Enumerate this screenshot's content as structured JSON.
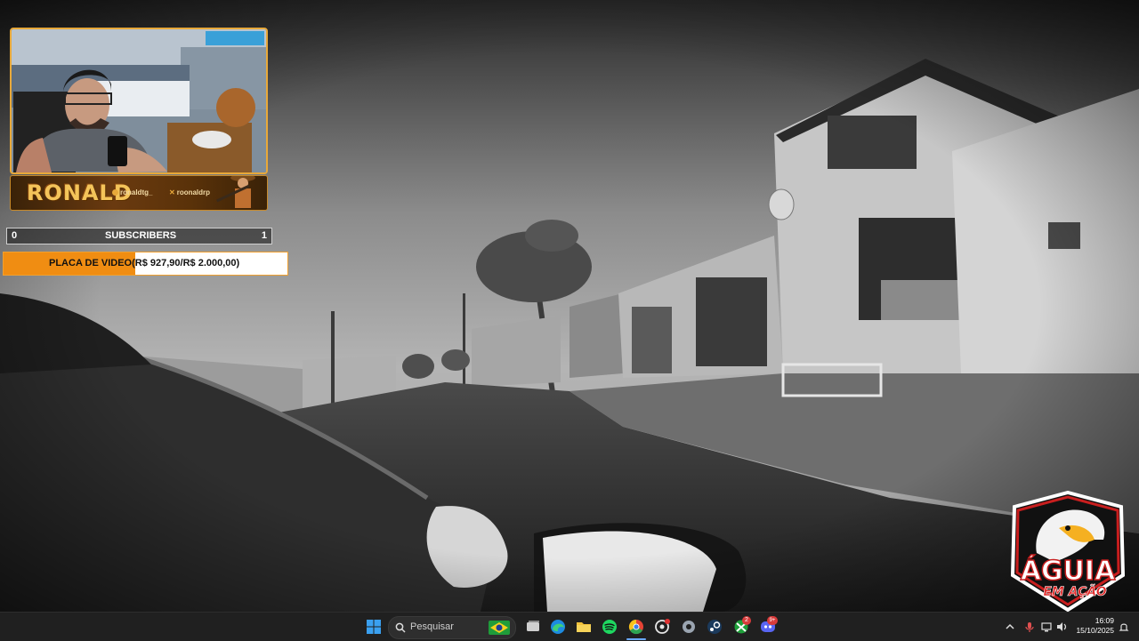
{
  "stream_overlay": {
    "streamer_name": "RONALD",
    "social_instagram": "ronaldtg_",
    "social_x": "roonaldrp",
    "subscribers": {
      "left_count": "0",
      "label": "SUBSCRIBERS",
      "right_count": "1"
    },
    "goal": {
      "title": "PLACA DE VIDEO",
      "progress_text": "(R$ 927,90/R$ 2.000,00)",
      "current": 927.9,
      "target": 2000.0,
      "fill_color": "#f08d12"
    },
    "logo": {
      "line1": "ÁGUIA",
      "line2": "EM AÇÃO"
    }
  },
  "taskbar": {
    "search_placeholder": "Pesquisar",
    "apps": [
      "windows-start",
      "task-view",
      "edge",
      "file-explorer",
      "spotify",
      "chrome",
      "chatgpt",
      "settings",
      "steam",
      "xbox",
      "discord"
    ],
    "xbox_badge": "2",
    "discord_badge": "9+",
    "time": "16:09",
    "date": "15/10/2025"
  },
  "colors": {
    "accent": "#e8a93a",
    "goal_fill": "#f08d12",
    "taskbar_bg": "#202020"
  }
}
